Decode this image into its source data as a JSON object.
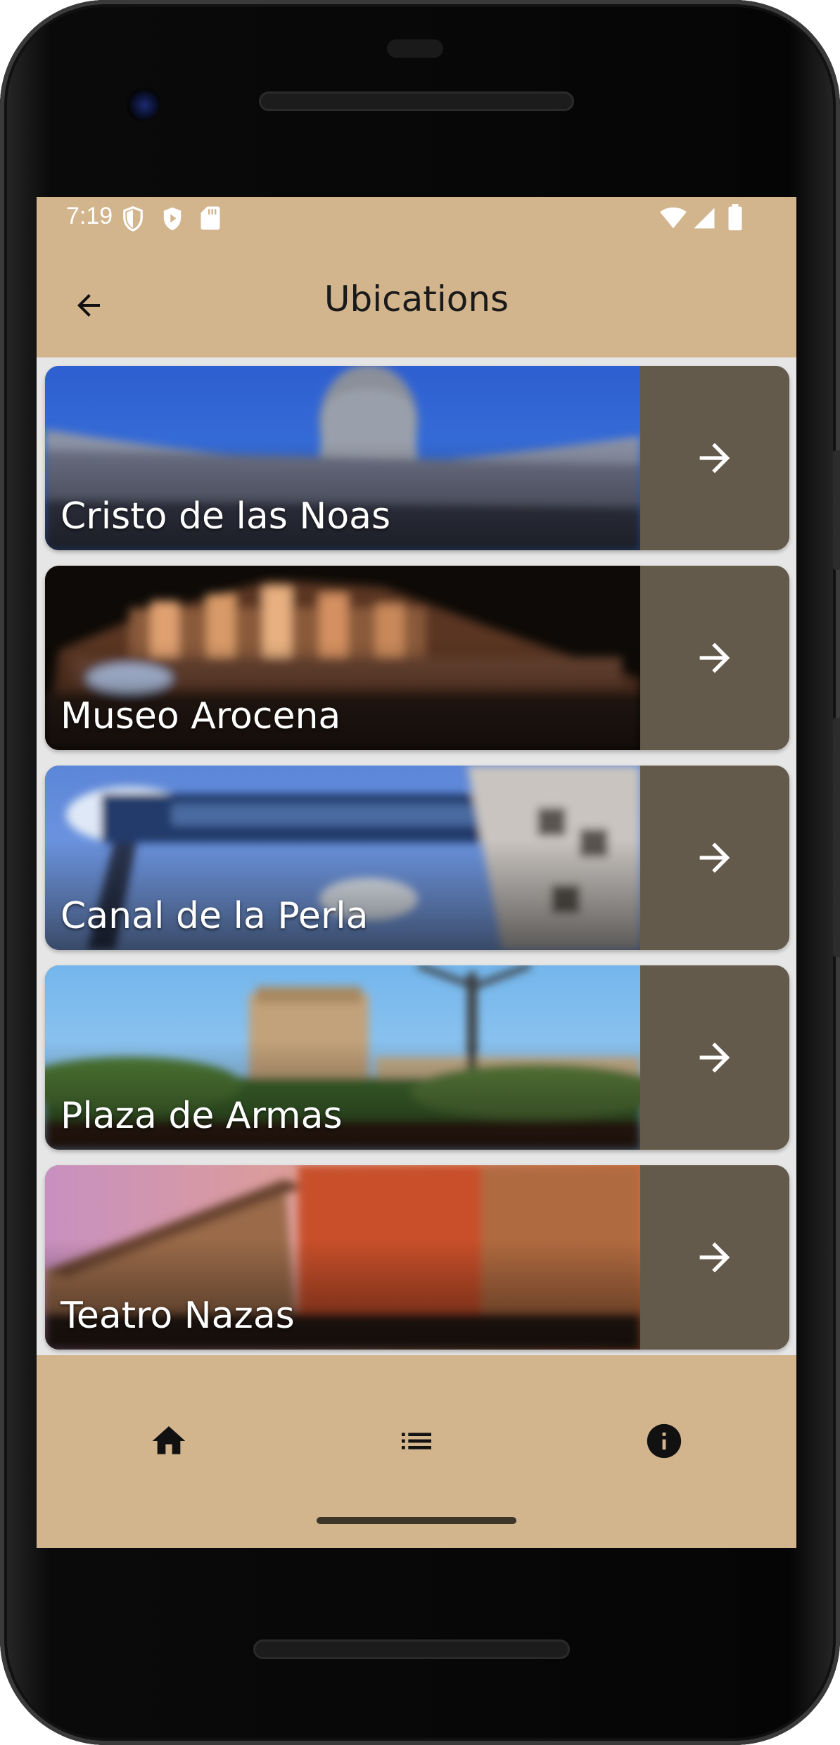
{
  "status_bar": {
    "time": "7:19",
    "left_icons": [
      "shield-outline-icon",
      "play-shield-icon",
      "sd-card-icon"
    ],
    "right_icons": [
      "wifi-icon",
      "cellular-signal-icon",
      "battery-icon"
    ],
    "background_color": "#d2b48d"
  },
  "app_bar": {
    "title": "Ubications",
    "back_icon": "arrow-back-icon",
    "background_color": "#d2b48d"
  },
  "locations": [
    {
      "name": "Cristo de las Noas",
      "action_icon": "arrow-forward-icon"
    },
    {
      "name": "Museo Arocena",
      "action_icon": "arrow-forward-icon"
    },
    {
      "name": "Canal de la Perla",
      "action_icon": "arrow-forward-icon"
    },
    {
      "name": "Plaza de Armas",
      "action_icon": "arrow-forward-icon"
    },
    {
      "name": "Teatro Nazas",
      "action_icon": "arrow-forward-icon"
    }
  ],
  "bottom_nav": {
    "items": [
      {
        "icon": "home-icon"
      },
      {
        "icon": "list-icon"
      },
      {
        "icon": "info-icon"
      }
    ],
    "background_color": "#d2b48d"
  },
  "colors": {
    "accent_tan": "#d2b48d",
    "card_action": "#645a4b",
    "list_background": "#e6e6e6"
  }
}
